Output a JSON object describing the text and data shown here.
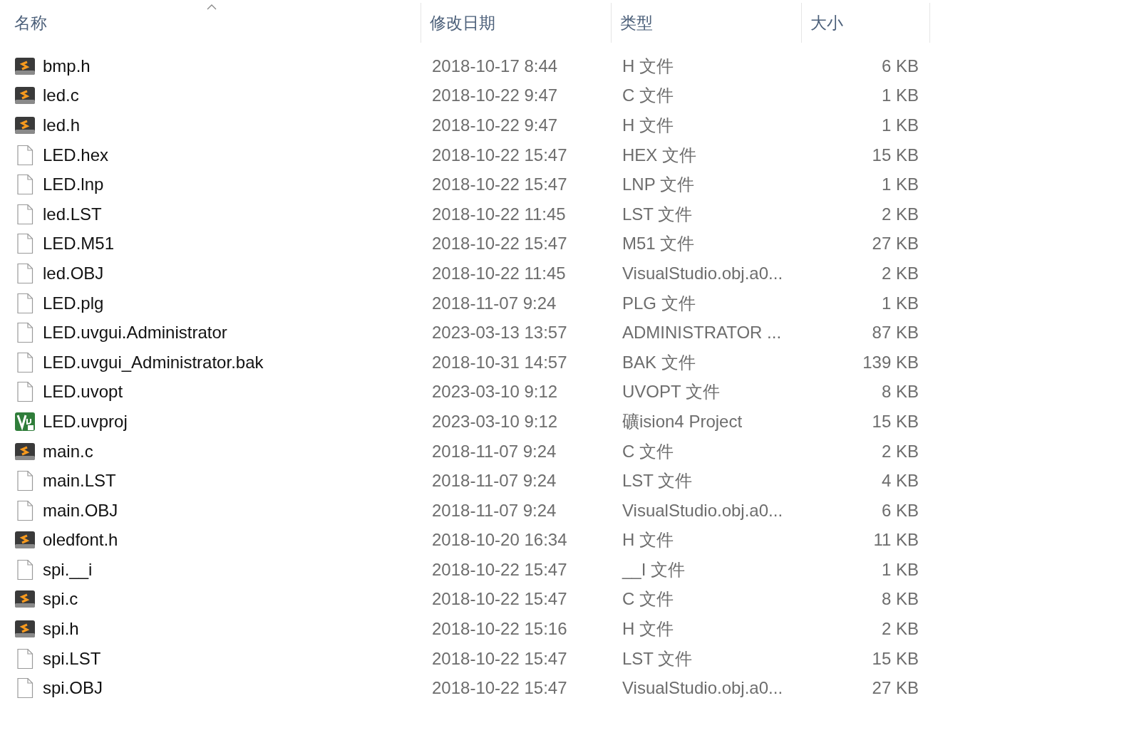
{
  "columns": [
    {
      "label": "名称",
      "sorted": true
    },
    {
      "label": "修改日期",
      "sorted": false
    },
    {
      "label": "类型",
      "sorted": false
    },
    {
      "label": "大小",
      "sorted": false
    }
  ],
  "files": [
    {
      "kind": "sublime",
      "name": "bmp.h",
      "modified": "2018-10-17 8:44",
      "type": "H 文件",
      "size": "6 KB"
    },
    {
      "kind": "sublime",
      "name": "led.c",
      "modified": "2018-10-22 9:47",
      "type": "C 文件",
      "size": "1 KB"
    },
    {
      "kind": "sublime",
      "name": "led.h",
      "modified": "2018-10-22 9:47",
      "type": "H 文件",
      "size": "1 KB"
    },
    {
      "kind": "blank",
      "name": "LED.hex",
      "modified": "2018-10-22 15:47",
      "type": "HEX 文件",
      "size": "15 KB"
    },
    {
      "kind": "blank",
      "name": "LED.lnp",
      "modified": "2018-10-22 15:47",
      "type": "LNP 文件",
      "size": "1 KB"
    },
    {
      "kind": "blank",
      "name": "led.LST",
      "modified": "2018-10-22 11:45",
      "type": "LST 文件",
      "size": "2 KB"
    },
    {
      "kind": "blank",
      "name": "LED.M51",
      "modified": "2018-10-22 15:47",
      "type": "M51 文件",
      "size": "27 KB"
    },
    {
      "kind": "blank",
      "name": "led.OBJ",
      "modified": "2018-10-22 11:45",
      "type": "VisualStudio.obj.a0...",
      "size": "2 KB"
    },
    {
      "kind": "blank",
      "name": "LED.plg",
      "modified": "2018-11-07 9:24",
      "type": "PLG 文件",
      "size": "1 KB"
    },
    {
      "kind": "blank",
      "name": "LED.uvgui.Administrator",
      "modified": "2023-03-13 13:57",
      "type": "ADMINISTRATOR ...",
      "size": "87 KB"
    },
    {
      "kind": "blank",
      "name": "LED.uvgui_Administrator.bak",
      "modified": "2018-10-31 14:57",
      "type": "BAK 文件",
      "size": "139 KB"
    },
    {
      "kind": "blank",
      "name": "LED.uvopt",
      "modified": "2023-03-10 9:12",
      "type": "UVOPT 文件",
      "size": "8 KB"
    },
    {
      "kind": "keil",
      "name": "LED.uvproj",
      "modified": "2023-03-10 9:12",
      "type": "礦ision4 Project",
      "size": "15 KB"
    },
    {
      "kind": "sublime",
      "name": "main.c",
      "modified": "2018-11-07 9:24",
      "type": "C 文件",
      "size": "2 KB"
    },
    {
      "kind": "blank",
      "name": "main.LST",
      "modified": "2018-11-07 9:24",
      "type": "LST 文件",
      "size": "4 KB"
    },
    {
      "kind": "blank",
      "name": "main.OBJ",
      "modified": "2018-11-07 9:24",
      "type": "VisualStudio.obj.a0...",
      "size": "6 KB"
    },
    {
      "kind": "sublime",
      "name": "oledfont.h",
      "modified": "2018-10-20 16:34",
      "type": "H 文件",
      "size": "11 KB"
    },
    {
      "kind": "blank",
      "name": "spi.__i",
      "modified": "2018-10-22 15:47",
      "type": "__I 文件",
      "size": "1 KB"
    },
    {
      "kind": "sublime",
      "name": "spi.c",
      "modified": "2018-10-22 15:47",
      "type": "C 文件",
      "size": "8 KB"
    },
    {
      "kind": "sublime",
      "name": "spi.h",
      "modified": "2018-10-22 15:16",
      "type": "H 文件",
      "size": "2 KB"
    },
    {
      "kind": "blank",
      "name": "spi.LST",
      "modified": "2018-10-22 15:47",
      "type": "LST 文件",
      "size": "15 KB"
    },
    {
      "kind": "blank",
      "name": "spi.OBJ",
      "modified": "2018-10-22 15:47",
      "type": "VisualStudio.obj.a0...",
      "size": "27 KB"
    }
  ]
}
